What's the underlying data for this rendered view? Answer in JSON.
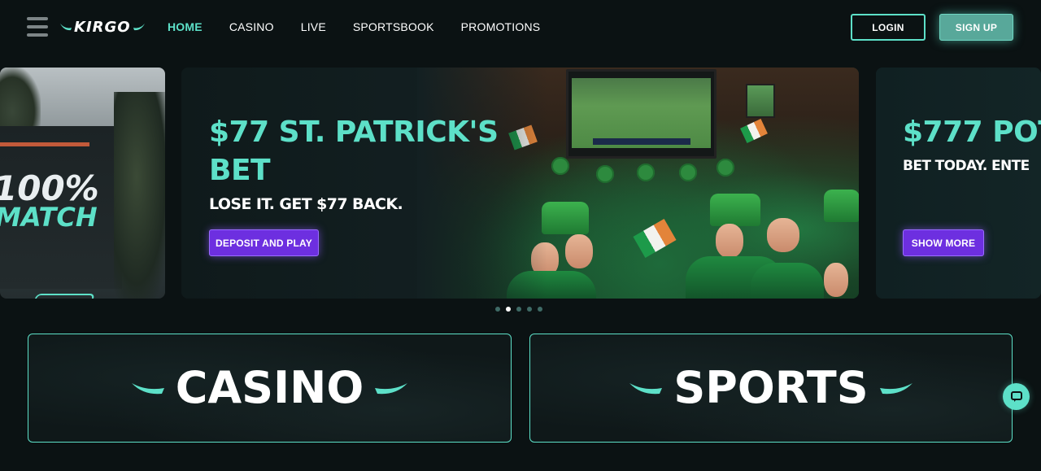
{
  "header": {
    "logo_text": "KIRGO",
    "nav": [
      {
        "label": "HOME",
        "active": true
      },
      {
        "label": "CASINO",
        "active": false
      },
      {
        "label": "LIVE",
        "active": false
      },
      {
        "label": "SPORTSBOOK",
        "active": false
      },
      {
        "label": "PROMOTIONS",
        "active": false
      }
    ],
    "login_label": "LOGIN",
    "signup_label": "SIGN UP"
  },
  "carousel": {
    "slides": [
      {
        "headline_line1": "100%",
        "headline_line2": "MATCH"
      },
      {
        "headline": "$77 ST. PATRICK'S BET",
        "subline": "LOSE IT. GET $77 BACK.",
        "cta": "DEPOSIT AND PLAY"
      },
      {
        "headline": "$777 POT",
        "subline": "BET TODAY. ENTE",
        "cta": "SHOW MORE"
      }
    ],
    "dot_count": 5,
    "active_dot": 1
  },
  "categories": [
    {
      "label": "CASINO"
    },
    {
      "label": "SPORTS"
    }
  ],
  "colors": {
    "accent": "#5de0c8",
    "cta_purple": "#6d2fe0",
    "background": "#0b1213"
  },
  "icons": {
    "menu": "hamburger-icon",
    "chat": "chat-bubble-icon"
  }
}
